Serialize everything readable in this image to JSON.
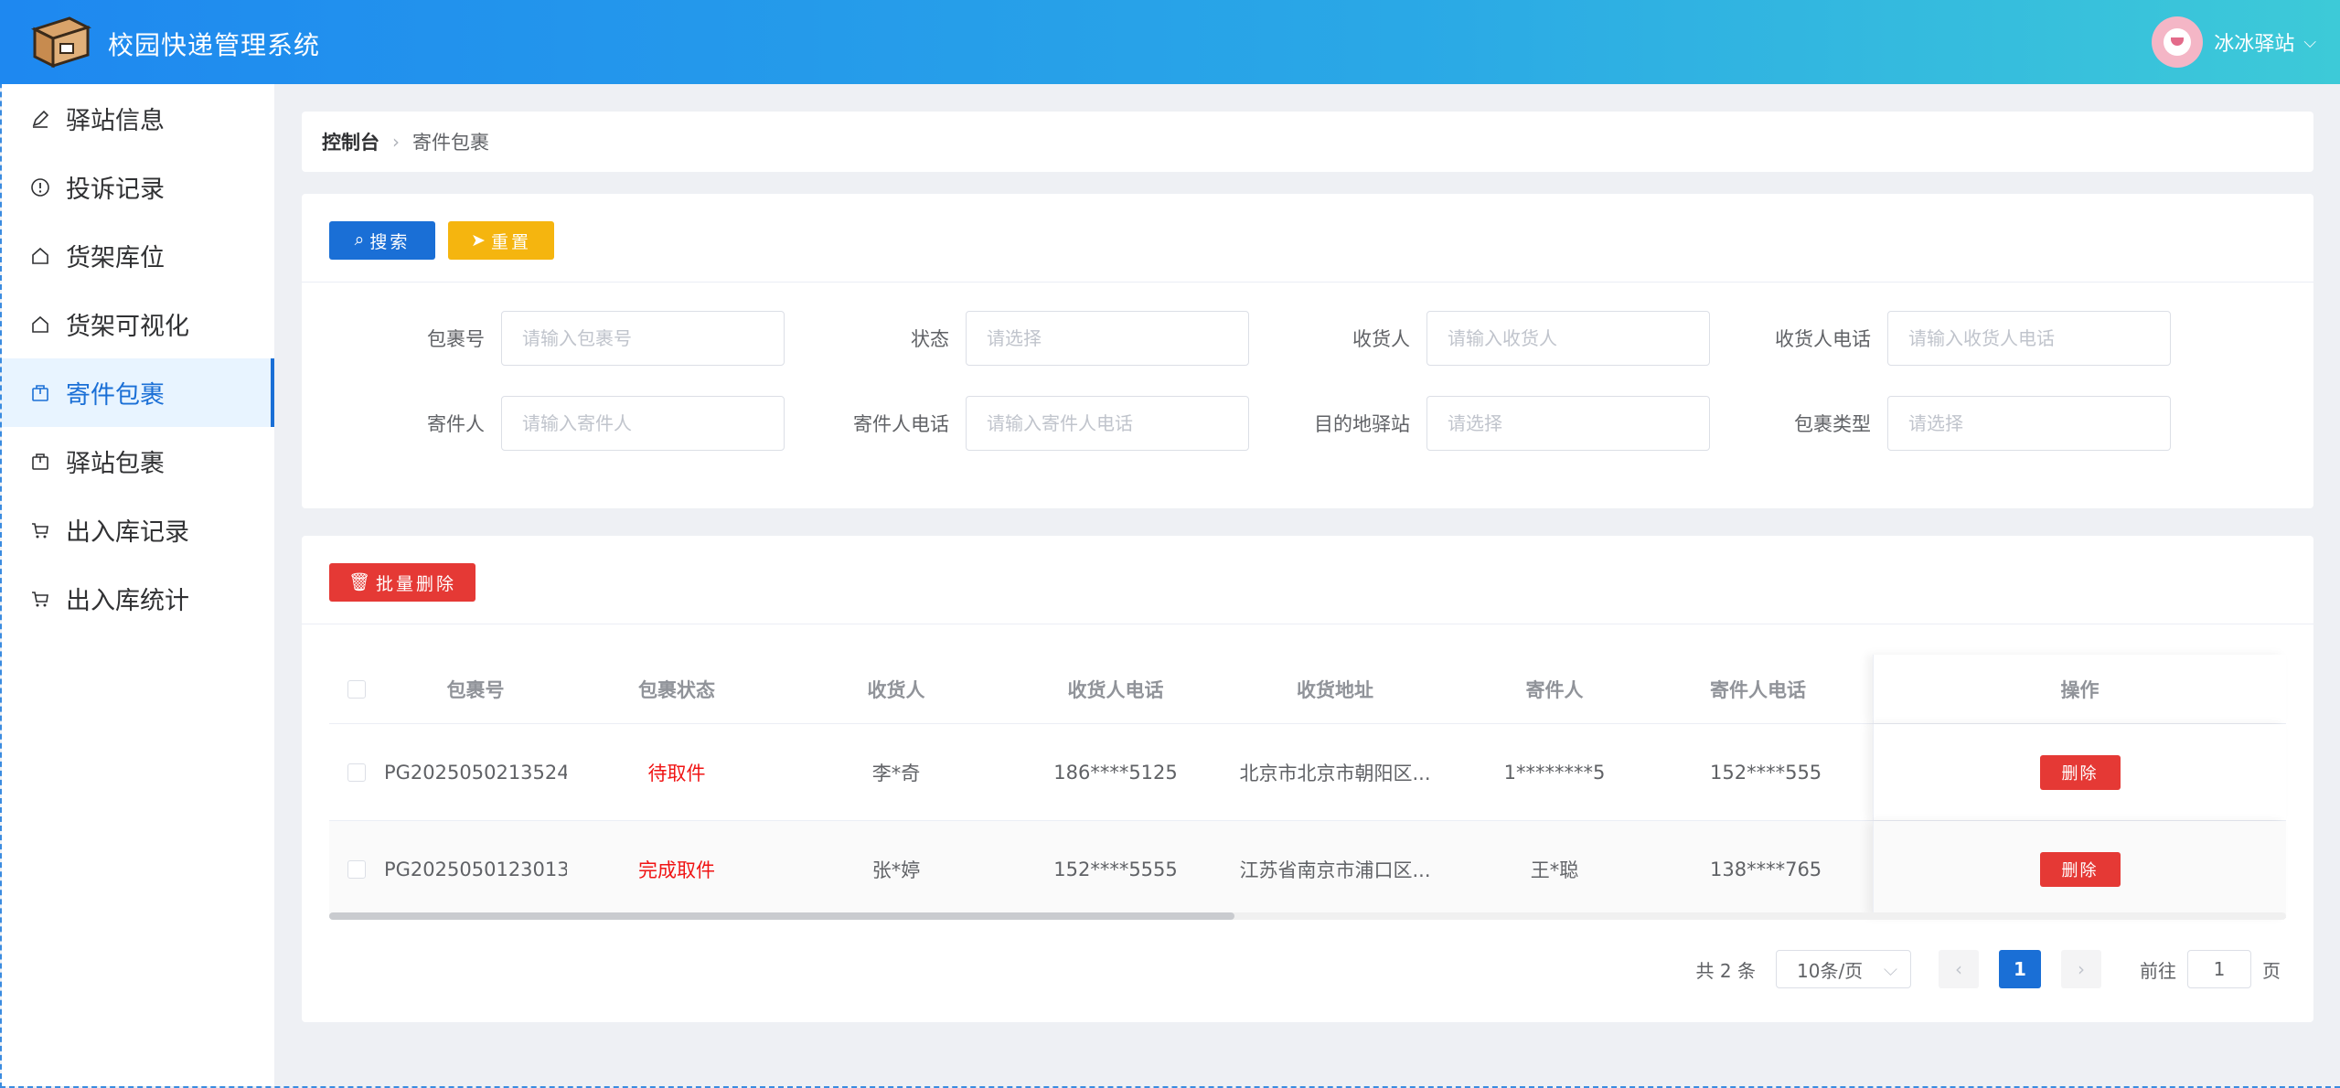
{
  "header": {
    "app_title": "校园快递管理系统",
    "user_name": "冰冰驿站"
  },
  "sidebar": {
    "items": [
      {
        "label": "驿站信息",
        "icon": "edit-icon"
      },
      {
        "label": "投诉记录",
        "icon": "alert-circle-icon"
      },
      {
        "label": "货架库位",
        "icon": "home-icon"
      },
      {
        "label": "货架可视化",
        "icon": "home-icon"
      },
      {
        "label": "寄件包裹",
        "icon": "package-icon",
        "active": true
      },
      {
        "label": "驿站包裹",
        "icon": "package-icon"
      },
      {
        "label": "出入库记录",
        "icon": "cart-icon"
      },
      {
        "label": "出入库统计",
        "icon": "cart-icon"
      }
    ]
  },
  "breadcrumb": {
    "root": "控制台",
    "current": "寄件包裹"
  },
  "search": {
    "search_button": "搜索",
    "reset_button": "重置",
    "fields": [
      {
        "label": "包裹号",
        "placeholder": "请输入包裹号"
      },
      {
        "label": "状态",
        "placeholder": "请选择"
      },
      {
        "label": "收货人",
        "placeholder": "请输入收货人"
      },
      {
        "label": "收货人电话",
        "placeholder": "请输入收货人电话"
      },
      {
        "label": "寄件人",
        "placeholder": "请输入寄件人"
      },
      {
        "label": "寄件人电话",
        "placeholder": "请输入寄件人电话"
      },
      {
        "label": "目的地驿站",
        "placeholder": "请选择"
      },
      {
        "label": "包裹类型",
        "placeholder": "请选择"
      }
    ]
  },
  "table": {
    "batch_delete_button": "批量删除",
    "columns": [
      "包裹号",
      "包裹状态",
      "收货人",
      "收货人电话",
      "收货地址",
      "寄件人",
      "寄件人电话",
      "操作"
    ],
    "rows": [
      {
        "package_no": "PG2025050213524...",
        "status": "待取件",
        "receiver": "李*奇",
        "receiver_phone": "186****5125",
        "address": "北京市北京市朝阳区...",
        "sender": "1********5",
        "sender_phone": "152****555",
        "action": "删除"
      },
      {
        "package_no": "PG2025050123013...",
        "status": "完成取件",
        "receiver": "张*婷",
        "receiver_phone": "152****5555",
        "address": "江苏省南京市浦口区...",
        "sender": "王*聪",
        "sender_phone": "138****765",
        "action": "删除"
      }
    ]
  },
  "pagination": {
    "total": "共 2 条",
    "page_size": "10条/页",
    "current_page": "1",
    "goto_label": "前往",
    "goto_value": "1",
    "page_suffix": "页"
  },
  "colors": {
    "primary": "#1a6fd6",
    "warning": "#f5b50f",
    "danger": "#e53935",
    "status_red": "#f01414"
  }
}
